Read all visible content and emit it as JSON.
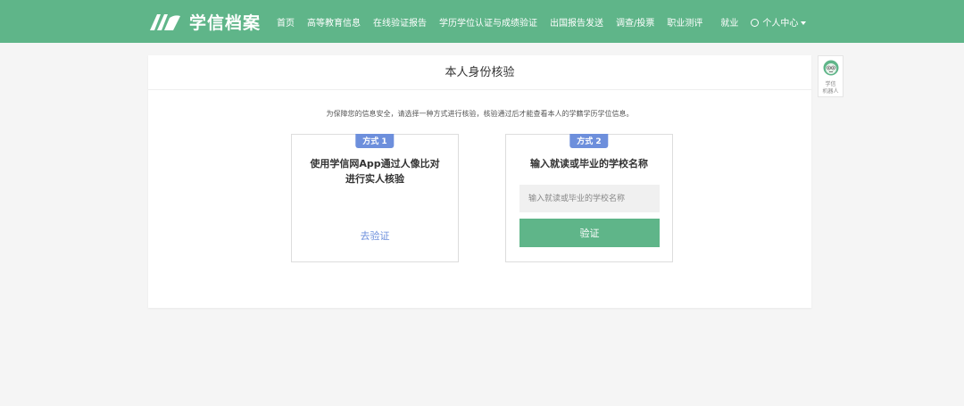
{
  "header": {
    "brand": "学信档案",
    "nav": [
      "首页",
      "高等教育信息",
      "在线验证报告",
      "学历学位认证与成绩验证",
      "出国报告发送",
      "调查/投票",
      "职业测评",
      "就业"
    ],
    "user_menu": "个人中心"
  },
  "page": {
    "title": "本人身份核验",
    "intro": "为保障您的信息安全，请选择一种方式进行核验，核验通过后才能查看本人的学籍学历学位信息。"
  },
  "option1": {
    "badge": "方式 1",
    "title_line1": "使用学信网App通过人像比对",
    "title_line2": "进行实人核验",
    "link": "去验证"
  },
  "option2": {
    "badge": "方式 2",
    "title": "输入就读或毕业的学校名称",
    "input_placeholder": "输入就读或毕业的学校名称",
    "input_value": "",
    "button": "验证"
  },
  "robot": {
    "line1": "学信",
    "line2": "机器人"
  },
  "colors": {
    "brand_green": "#5fb589",
    "accent_blue": "#6d8fdc"
  },
  "icons": {
    "logo": "xuexin-logo-icon",
    "user": "user-circle-icon",
    "caret": "caret-down-icon",
    "robot": "robot-avatar-icon"
  }
}
